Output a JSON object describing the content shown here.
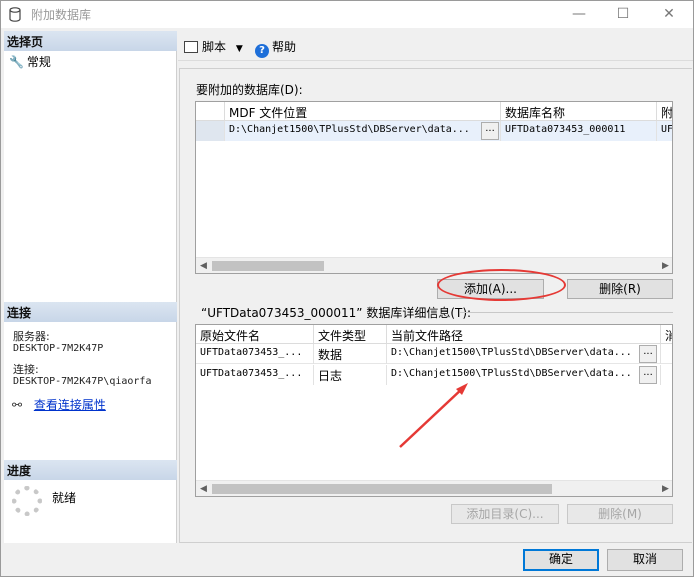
{
  "window": {
    "title": "附加数据库",
    "minimize": "—",
    "maximize": "☐",
    "close": "✕"
  },
  "left": {
    "select_page_header": "选择页",
    "pages": [
      {
        "label": "常规",
        "icon": "wrench-icon"
      }
    ],
    "connection_header": "连接",
    "server_label": "服务器:",
    "server_value": "DESKTOP-7M2K47P",
    "connection_label": "连接:",
    "connection_value": "DESKTOP-7M2K47P\\qiaorfa",
    "view_props_link": "查看连接属性",
    "progress_header": "进度",
    "status": "就绪"
  },
  "toolbar": {
    "script_label": "脚本",
    "help_label": "帮助"
  },
  "attach": {
    "label": "要附加的数据库(D):",
    "columns": [
      "MDF 文件位置",
      "数据库名称",
      "附"
    ],
    "rows": [
      {
        "mdf": "D:\\Chanjet1500\\TPlusStd\\DBServer\\data...",
        "btn": "...",
        "db_name": "UFTData073453_000011",
        "extra": "UF"
      }
    ],
    "add_button": "添加(A)...",
    "remove_button": "删除(R)"
  },
  "details": {
    "label": "“UFTData073453_000011” 数据库详细信息(T):",
    "columns": [
      "原始文件名",
      "文件类型",
      "当前文件路径",
      "消"
    ],
    "rows": [
      {
        "name": "UFTData073453_...",
        "type": "数据",
        "path": "D:\\Chanjet1500\\TPlusStd\\DBServer\\data...",
        "btn": "..."
      },
      {
        "name": "UFTData073453_...",
        "type": "日志",
        "path": "D:\\Chanjet1500\\TPlusStd\\DBServer\\data...",
        "btn": "..."
      }
    ],
    "add_catalog_button": "添加目录(C)...",
    "remove_button": "删除(M)"
  },
  "footer": {
    "ok_button": "确定",
    "cancel_button": "取消"
  },
  "colors": {
    "annotation": "#e53935",
    "accent": "#0078d7",
    "link": "#0033cc"
  }
}
